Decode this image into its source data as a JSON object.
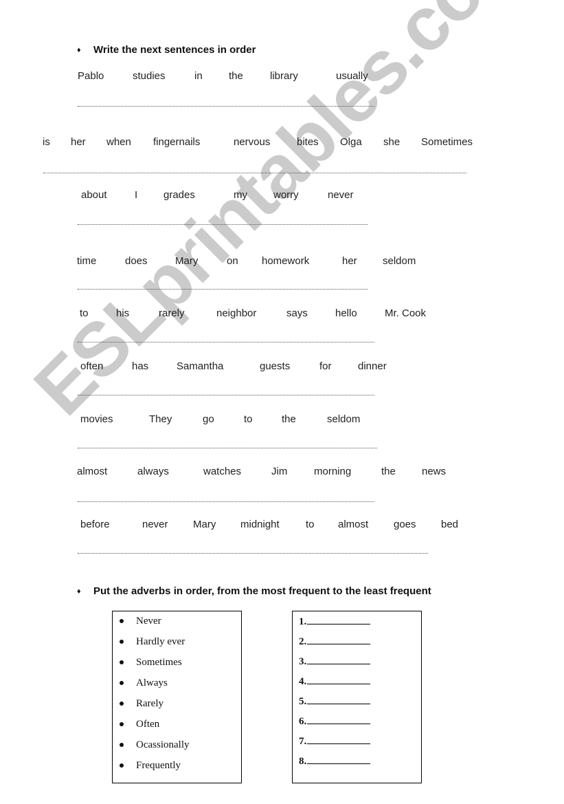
{
  "section1": {
    "bullet_icon": "diamond",
    "title": "Write the next sentences in order",
    "exercises": [
      {
        "words": [
          "Pablo",
          "studies",
          "in",
          "the",
          "library",
          "usually"
        ]
      },
      {
        "words": [
          "is",
          "her",
          "when",
          "fingernails",
          "nervous",
          "bites",
          "Olga",
          "she",
          "Sometimes"
        ]
      },
      {
        "words": [
          "about",
          "I",
          "grades",
          "my",
          "worry",
          "never"
        ]
      },
      {
        "words": [
          "time",
          "does",
          "Mary",
          "on",
          "homework",
          "her",
          "seldom"
        ]
      },
      {
        "words": [
          "to",
          "his",
          "rarely",
          "neighbor",
          "says",
          "hello",
          "Mr. Cook"
        ]
      },
      {
        "words": [
          "often",
          "has",
          "Samantha",
          "guests",
          "for",
          "dinner"
        ]
      },
      {
        "words": [
          "movies",
          "They",
          "go",
          "to",
          "the",
          "seldom"
        ]
      },
      {
        "words": [
          "almost",
          "always",
          "watches",
          "Jim",
          "morning",
          "the",
          "news"
        ]
      },
      {
        "words": [
          "before",
          "never",
          "Mary",
          "midnight",
          "to",
          "almost",
          "goes",
          "bed"
        ]
      }
    ]
  },
  "section2": {
    "bullet_icon": "diamond",
    "title": "Put the adverbs in order, from the most frequent to the least frequent",
    "adverbs": [
      "Never",
      "Hardly ever",
      "Sometimes",
      "Always",
      "Rarely",
      "Often",
      "Ocassionally",
      "Frequently"
    ],
    "answers": [
      "1.",
      "2.",
      "3.",
      "4.",
      "5.",
      "6.",
      "7.",
      "8."
    ]
  },
  "watermark": "ESLprintables.com"
}
